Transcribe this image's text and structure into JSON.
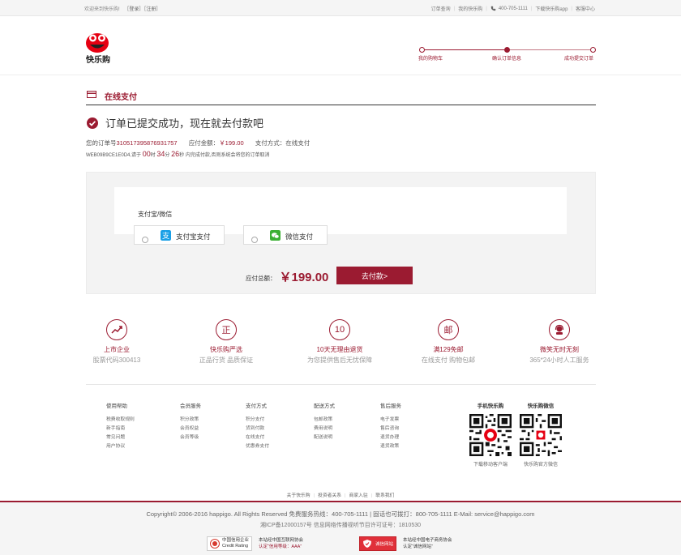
{
  "topbar": {
    "welcome": "欢迎来到快乐购!",
    "login": "［登录］",
    "register": "［注册］",
    "links": [
      "订单查询",
      "我的快乐购"
    ],
    "phone": "400-705-1111",
    "app": "下载快乐购app",
    "service": "客服中心"
  },
  "header": {
    "logo_text": "快乐购",
    "steps": [
      "我的购物车",
      "确认订单信息",
      "成功提交订单"
    ],
    "active_step": 1
  },
  "section": {
    "title": "在线支付"
  },
  "order": {
    "success_msg": "订单已提交成功，现在就去付款吧",
    "order_no_label": "您的订单号",
    "order_no": "310517395876931757",
    "amount_label": "应付金额：",
    "amount": "￥199.00",
    "method_label": "支付方式：在线支付",
    "deadline_prefix": "WEB09B9CE1E0D4,请于",
    "h": "00",
    "h_unit": "时",
    "m": "34",
    "m_unit": "分",
    "s": "26",
    "s_unit": "秒",
    "deadline_suffix": "内完成付款,否则系统会将您的订单取消"
  },
  "payment": {
    "method_title": "支付宝/微信",
    "options": [
      {
        "label": "支付宝支付",
        "color": "#1a9fe6"
      },
      {
        "label": "微信支付",
        "color": "#3cb034"
      }
    ],
    "total_label": "应付总额：",
    "total": "￥199.00",
    "pay_button": "去付款>"
  },
  "features": [
    {
      "title": "上市企业",
      "sub": "股票代码300413",
      "glyph": ""
    },
    {
      "title": "快乐购严选",
      "sub": "正品行货 品质保证",
      "glyph": "正"
    },
    {
      "title": "10天无理由退货",
      "sub": "为您提供售后无忧保障",
      "glyph": "10"
    },
    {
      "title": "满129免邮",
      "sub": "在线支付 购物包邮",
      "glyph": "邮"
    },
    {
      "title": "微笑无时无刻",
      "sub": "365*24小时人工服务",
      "glyph": ""
    }
  ],
  "help": [
    {
      "title": "使用帮助",
      "items": [
        "税费收取规则",
        "新手指南",
        "常见问题",
        "用户协议"
      ]
    },
    {
      "title": "会员服务",
      "items": [
        "积分政策",
        "会员权益",
        "会员等级"
      ]
    },
    {
      "title": "支付方式",
      "items": [
        "积分支付",
        "货到付款",
        "在线支付",
        "优惠券支付"
      ]
    },
    {
      "title": "配送方式",
      "items": [
        "包邮政策",
        "费用说明",
        "配送说明"
      ]
    },
    {
      "title": "售后服务",
      "items": [
        "电子发票",
        "售后咨询",
        "退货办理",
        "退货政策"
      ]
    }
  ],
  "qr": [
    {
      "title": "手机快乐购",
      "sub": "下载移动客户端"
    },
    {
      "title": "快乐购微信",
      "sub": "快乐购官方微信"
    }
  ],
  "bottom_links": [
    "关于快乐购",
    "投资者关系",
    "商家入驻",
    "联系我们"
  ],
  "footer": {
    "copyright": "Copyright© 2006-2016 happigo. All Rights Reserved 免费服务热线：400-705-1111 | 固话也可拨打：800-705-1111 E-Mail: service@happigo.com",
    "icp": "湘ICP备12000157号 信息网络传播视听节目许可证号：1810530",
    "badge1_line1": "中国信用企业",
    "badge1_line2": "Credit Rating",
    "badge1_txt1": "本站经中国互联网协会",
    "badge1_txt2": "认定“信用等级：AAA”",
    "badge2_label": "诚信网站",
    "badge2_txt1": "本站经中国电子商务协会",
    "badge2_txt2": "认定“诚信网站”"
  },
  "colors": {
    "brand": "#9b1b31"
  }
}
